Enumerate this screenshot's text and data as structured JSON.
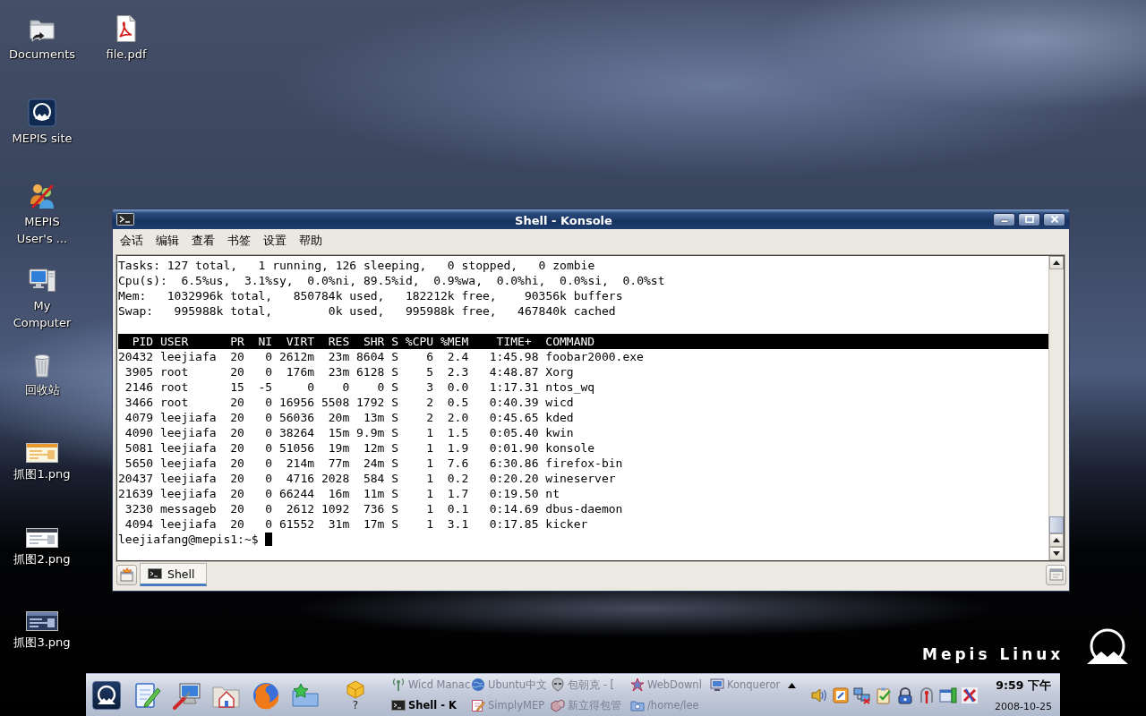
{
  "desktop_icons": [
    {
      "label": "Documents",
      "kind": "folder"
    },
    {
      "label": "file.pdf",
      "kind": "pdf"
    },
    {
      "label": "MEPIS site",
      "kind": "website"
    },
    {
      "label": "MEPIS User's ...",
      "kind": "users"
    },
    {
      "label": "My Computer",
      "kind": "computer"
    },
    {
      "label": "回收站",
      "kind": "trash"
    },
    {
      "label": "抓图1.png",
      "kind": "image"
    },
    {
      "label": "抓图2.png",
      "kind": "image"
    },
    {
      "label": "抓图3.png",
      "kind": "image"
    }
  ],
  "wallpaper_logo": {
    "text": "Mepis Linux"
  },
  "window": {
    "title": "Shell - Konsole",
    "menu": [
      "会话",
      "编辑",
      "查看",
      "书签",
      "设置",
      "帮助"
    ],
    "terminal": {
      "summary": [
        "Tasks: 127 total,   1 running, 126 sleeping,   0 stopped,   0 zombie",
        "Cpu(s):  6.5%us,  3.1%sy,  0.0%ni, 89.5%id,  0.9%wa,  0.0%hi,  0.0%si,  0.0%st",
        "Mem:   1032996k total,   850784k used,   182212k free,    90356k buffers",
        "Swap:   995988k total,        0k used,   995988k free,   467840k cached"
      ],
      "table": {
        "columns": [
          "PID",
          "USER",
          "PR",
          "NI",
          "VIRT",
          "RES",
          "SHR",
          "S",
          "%CPU",
          "%MEM",
          "TIME+",
          "COMMAND"
        ],
        "rows": [
          [
            "20432",
            "leejiafa",
            "20",
            "0",
            "2612m",
            "23m",
            "8604",
            "S",
            "6",
            "2.4",
            "1:45.98",
            "foobar2000.exe"
          ],
          [
            "3905",
            "root",
            "20",
            "0",
            "176m",
            "23m",
            "6128",
            "S",
            "5",
            "2.3",
            "4:48.87",
            "Xorg"
          ],
          [
            "2146",
            "root",
            "15",
            "-5",
            "0",
            "0",
            "0",
            "S",
            "3",
            "0.0",
            "1:17.31",
            "ntos_wq"
          ],
          [
            "3466",
            "root",
            "20",
            "0",
            "16956",
            "5508",
            "1792",
            "S",
            "2",
            "0.5",
            "0:40.39",
            "wicd"
          ],
          [
            "4079",
            "leejiafa",
            "20",
            "0",
            "56036",
            "20m",
            "13m",
            "S",
            "2",
            "2.0",
            "0:45.65",
            "kded"
          ],
          [
            "4090",
            "leejiafa",
            "20",
            "0",
            "38264",
            "15m",
            "9.9m",
            "S",
            "1",
            "1.5",
            "0:05.40",
            "kwin"
          ],
          [
            "5081",
            "leejiafa",
            "20",
            "0",
            "51056",
            "19m",
            "12m",
            "S",
            "1",
            "1.9",
            "0:01.90",
            "konsole"
          ],
          [
            "5650",
            "leejiafa",
            "20",
            "0",
            "214m",
            "77m",
            "24m",
            "S",
            "1",
            "7.6",
            "6:30.86",
            "firefox-bin"
          ],
          [
            "20437",
            "leejiafa",
            "20",
            "0",
            "4716",
            "2028",
            "584",
            "S",
            "1",
            "0.2",
            "0:20.20",
            "wineserver"
          ],
          [
            "21639",
            "leejiafa",
            "20",
            "0",
            "66244",
            "16m",
            "11m",
            "S",
            "1",
            "1.7",
            "0:19.50",
            "nt"
          ],
          [
            "3230",
            "messageb",
            "20",
            "0",
            "2612",
            "1092",
            "736",
            "S",
            "1",
            "0.1",
            "0:14.69",
            "dbus-daemon"
          ],
          [
            "4094",
            "leejiafa",
            "20",
            "0",
            "61552",
            "31m",
            "17m",
            "S",
            "1",
            "3.1",
            "0:17.85",
            "kicker"
          ]
        ]
      },
      "prompt": "leejiafang@mepis1:~$"
    },
    "tabs": [
      {
        "label": "Shell",
        "selected": true
      }
    ]
  },
  "taskbar": {
    "applet": {
      "label": "?"
    },
    "tasks": [
      {
        "label": "Wicd Manac",
        "kind": "antenna",
        "selected": false
      },
      {
        "label": "Ubuntu中文",
        "kind": "globe",
        "selected": false
      },
      {
        "label": "包朝克 - [",
        "kind": "alien",
        "selected": false
      },
      {
        "label": "WebDownl",
        "kind": "star",
        "selected": false
      },
      {
        "label": "Konqueror",
        "kind": "monitor",
        "selected": false
      },
      {
        "label": "Shell - K",
        "kind": "terminal",
        "selected": true
      },
      {
        "label": "SimplyMEP",
        "kind": "notepad",
        "selected": false
      },
      {
        "label": "新立得包管",
        "kind": "package",
        "selected": false
      },
      {
        "label": "/home/lee",
        "kind": "folder",
        "selected": false
      }
    ],
    "clock": {
      "time": "9:59 下午",
      "date": "2008-10-25"
    }
  }
}
